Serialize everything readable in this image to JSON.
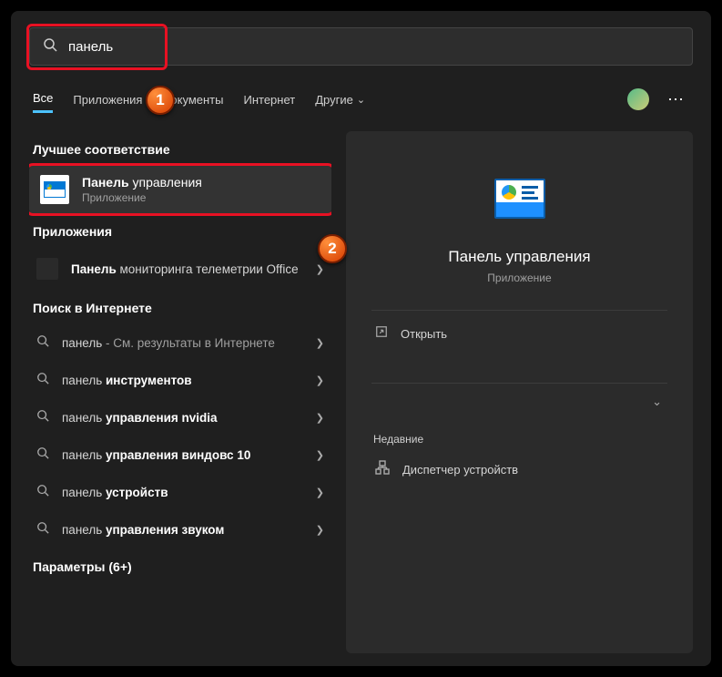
{
  "search": {
    "value": "панель"
  },
  "tabs": [
    {
      "label": "Все",
      "active": true,
      "chevron": false
    },
    {
      "label": "Приложения",
      "active": false,
      "chevron": false
    },
    {
      "label": "Документы",
      "active": false,
      "chevron": false
    },
    {
      "label": "Интернет",
      "active": false,
      "chevron": false
    },
    {
      "label": "Другие",
      "active": false,
      "chevron": true
    }
  ],
  "badges": {
    "b1": "1",
    "b2": "2"
  },
  "left": {
    "best_match_title": "Лучшее соответствие",
    "best_match": {
      "title_match": "Панель",
      "title_rest": " управления",
      "subtitle": "Приложение"
    },
    "apps_title": "Приложения",
    "apps": [
      {
        "title_match": "Панель",
        "title_rest": " мониторинга телеметрии Office"
      }
    ],
    "web_title": "Поиск в Интернете",
    "web": [
      {
        "pre": "панель",
        "bold": "",
        "rest": " - См. результаты в Интернете"
      },
      {
        "pre": "панель ",
        "bold": "инструментов",
        "rest": ""
      },
      {
        "pre": "панель ",
        "bold": "управления nvidia",
        "rest": ""
      },
      {
        "pre": "панель ",
        "bold": "управления виндовс 10",
        "rest": ""
      },
      {
        "pre": "панель ",
        "bold": "устройств",
        "rest": ""
      },
      {
        "pre": "панель ",
        "bold": "управления звуком",
        "rest": ""
      }
    ],
    "settings_title": "Параметры (6+)"
  },
  "right": {
    "title": "Панель управления",
    "subtitle": "Приложение",
    "open_label": "Открыть",
    "recent_title": "Недавние",
    "recent": [
      {
        "label": "Диспетчер устройств"
      }
    ]
  }
}
